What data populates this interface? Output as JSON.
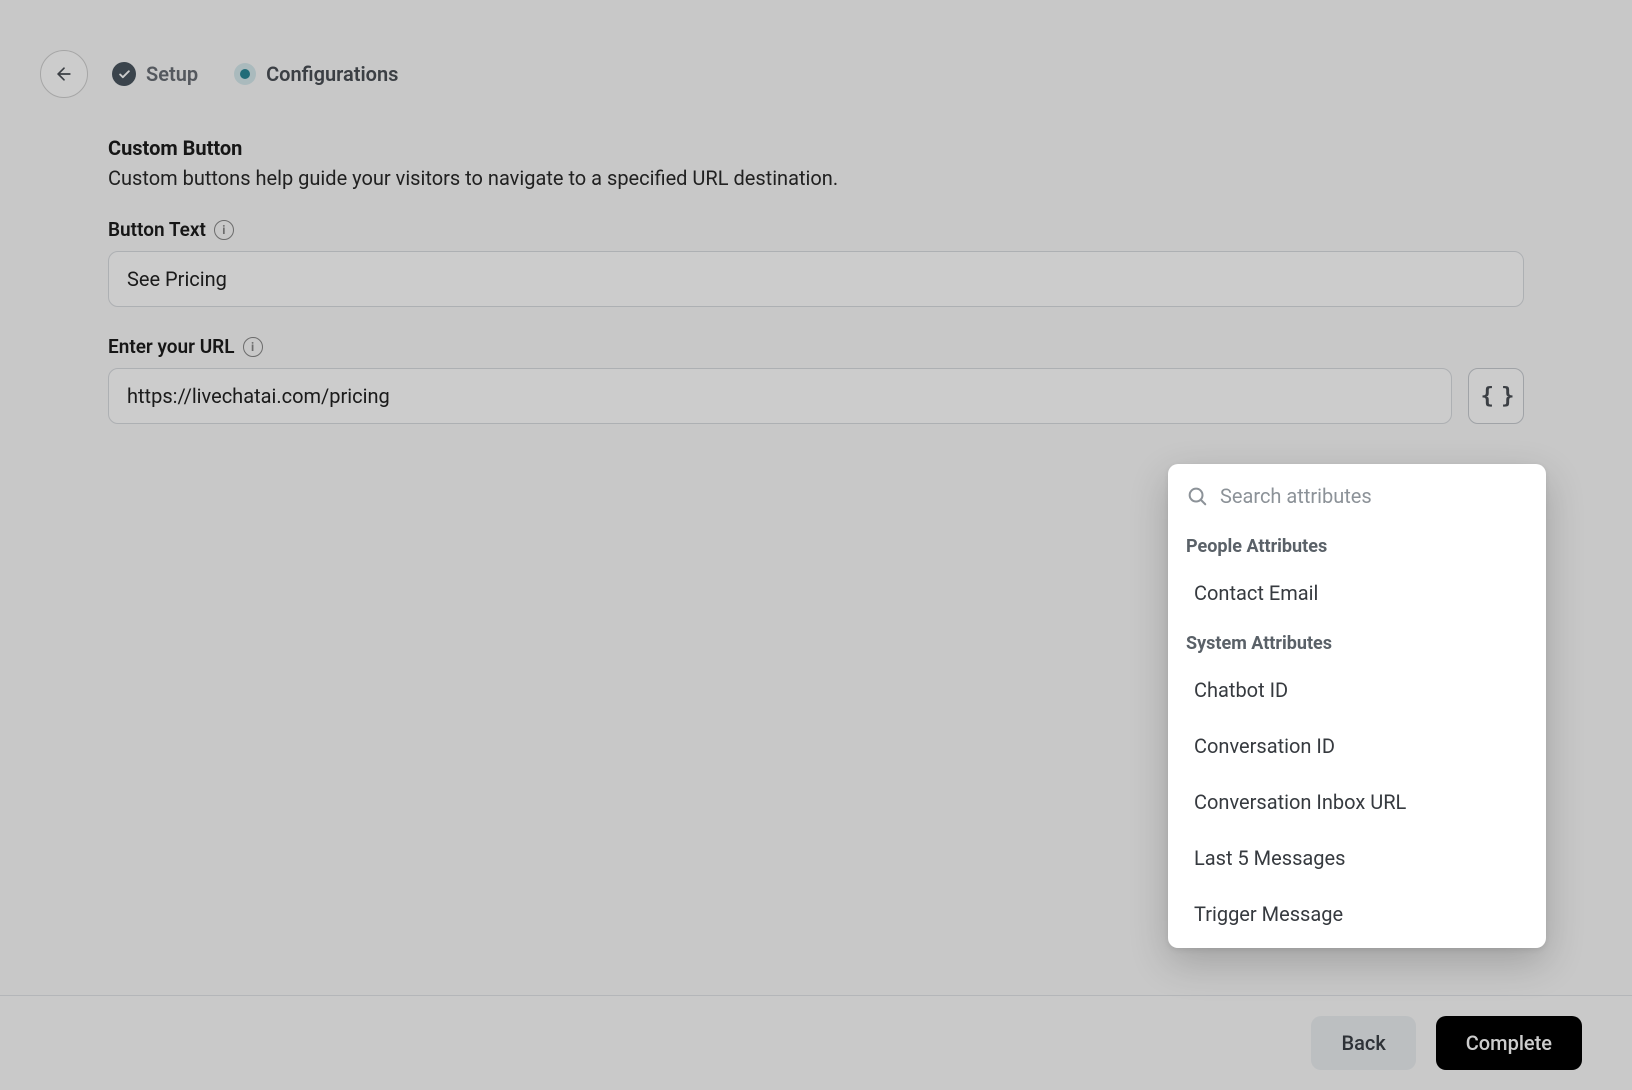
{
  "header": {
    "steps": {
      "setup": "Setup",
      "configurations": "Configurations"
    }
  },
  "section": {
    "title": "Custom Button",
    "description": "Custom buttons help guide your visitors to navigate to a specified URL destination."
  },
  "fields": {
    "button_text": {
      "label": "Button Text",
      "value": "See Pricing"
    },
    "url": {
      "label": "Enter your URL",
      "value": "https://livechatai.com/pricing"
    }
  },
  "attributes_popover": {
    "search_placeholder": "Search attributes",
    "groups": [
      {
        "title": "People Attributes",
        "items": [
          "Contact Email"
        ]
      },
      {
        "title": "System Attributes",
        "items": [
          "Chatbot ID",
          "Conversation ID",
          "Conversation Inbox URL",
          "Last 5 Messages",
          "Trigger Message"
        ]
      }
    ]
  },
  "footer": {
    "back": "Back",
    "complete": "Complete"
  }
}
